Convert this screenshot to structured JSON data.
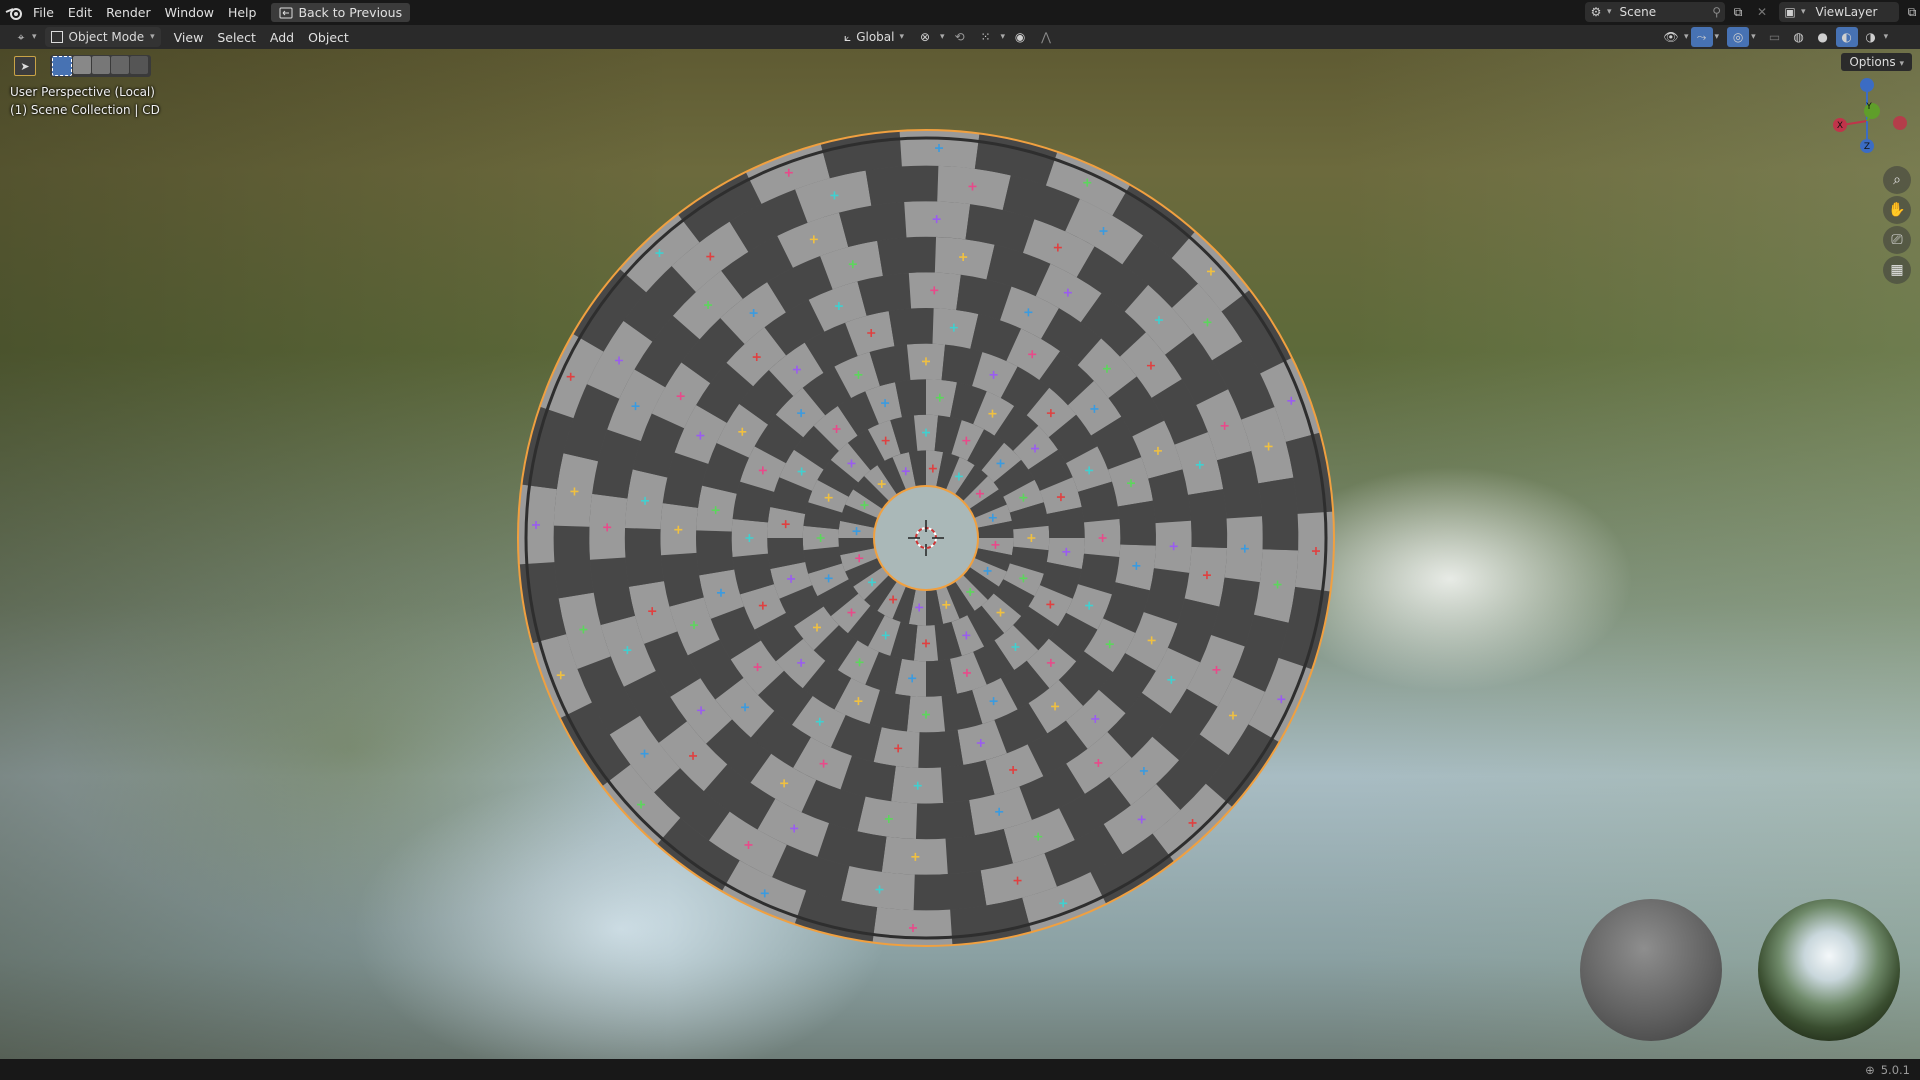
{
  "topbar": {
    "menus": [
      "File",
      "Edit",
      "Render",
      "Window",
      "Help"
    ],
    "back_button": "Back to Previous",
    "scene_label": "Scene",
    "viewlayer_label": "ViewLayer"
  },
  "header": {
    "mode": "Object Mode",
    "menus": [
      "View",
      "Select",
      "Add",
      "Object"
    ],
    "transform_orientation": "Global",
    "options_label": "Options"
  },
  "viewport": {
    "perspective_label": "User Perspective (Local)",
    "collection_label": "(1) Scene Collection | CD",
    "gizmo": {
      "x": "X",
      "y": "Y",
      "z": "Z"
    }
  },
  "statusbar": {
    "version": "5.0.1"
  },
  "icons": [
    "blender-logo-icon",
    "editor-type-icon",
    "object-mode-icon",
    "select-box-icon",
    "transform-orientation-icon",
    "pivot-icon",
    "snap-icon",
    "proportional-edit-icon",
    "visibility-icon",
    "gizmo-icon",
    "overlay-icon",
    "xray-icon",
    "wireframe-shading-icon",
    "solid-shading-icon",
    "material-shading-icon",
    "rendered-shading-icon",
    "zoom-icon",
    "pan-hand-icon",
    "camera-icon",
    "grid-icon"
  ],
  "colors": {
    "selection_outline": "#f0a040",
    "accent_blue": "#4772b3"
  }
}
